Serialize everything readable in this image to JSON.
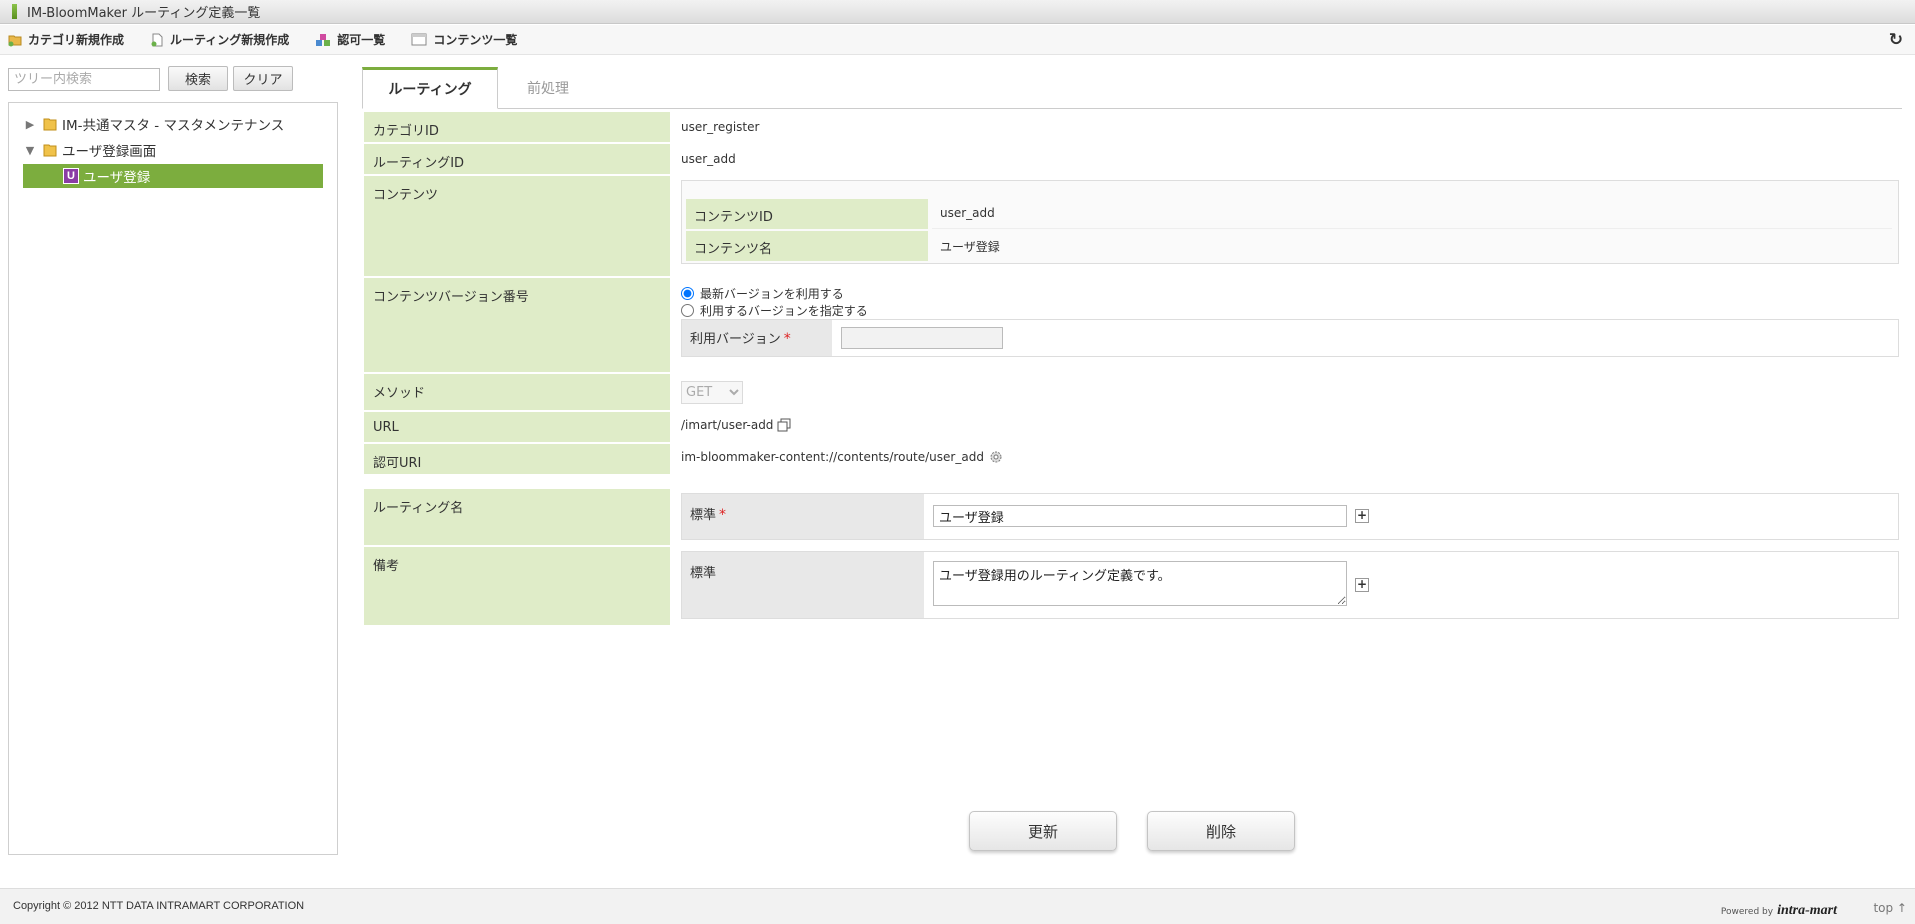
{
  "window": {
    "title": "IM-BloomMaker ルーティング定義一覧"
  },
  "toolbar": {
    "items": [
      {
        "label": "カテゴリ新規作成",
        "icon": "folder-new-icon"
      },
      {
        "label": "ルーティング新規作成",
        "icon": "document-new-icon"
      },
      {
        "label": "認可一覧",
        "icon": "shapes-icon"
      },
      {
        "label": "コンテンツ一覧",
        "icon": "window-icon"
      }
    ],
    "refresh_icon": "refresh-icon",
    "refresh_glyph": "↻"
  },
  "sidebar": {
    "search_placeholder": "ツリー内検索",
    "search_label": "検索",
    "clear_label": "クリア",
    "tree": [
      {
        "label": "IM-共通マスタ - マスタメンテナンス",
        "expanded": false
      },
      {
        "label": "ユーザ登録画面",
        "expanded": true
      },
      {
        "label": "ユーザ登録",
        "selected": true,
        "badge": "U"
      }
    ]
  },
  "tabs": [
    {
      "label": "ルーティング",
      "active": true
    },
    {
      "label": "前処理",
      "active": false
    }
  ],
  "form": {
    "category_id": {
      "label": "カテゴリID",
      "value": "user_register"
    },
    "routing_id": {
      "label": "ルーティングID",
      "value": "user_add"
    },
    "contents": {
      "label": "コンテンツ",
      "id_label": "コンテンツID",
      "id_value": "user_add",
      "name_label": "コンテンツ名",
      "name_value": "ユーザ登録"
    },
    "version": {
      "label": "コンテンツバージョン番号",
      "option_latest": "最新バージョンを利用する",
      "option_specify": "利用するバージョンを指定する",
      "use_version_label": "利用バージョン",
      "use_version_value": ""
    },
    "method": {
      "label": "メソッド",
      "value": "GET"
    },
    "url": {
      "label": "URL",
      "value": "/imart/user-add"
    },
    "auth_uri": {
      "label": "認可URI",
      "value": "im-bloommaker-content://contents/route/user_add"
    },
    "routing_name": {
      "label": "ルーティング名",
      "sub_label": "標準",
      "value": "ユーザ登録"
    },
    "remarks": {
      "label": "備考",
      "sub_label": "標準",
      "value": "ユーザ登録用のルーティング定義です。"
    },
    "required_mark": "*",
    "plus_glyph": "+"
  },
  "actions": {
    "update_label": "更新",
    "delete_label": "削除"
  },
  "footer": {
    "copyright": "Copyright © 2012 NTT DATA INTRAMART CORPORATION",
    "powered_by": "Powered by",
    "brand": "intra-mart",
    "top_label": "top ↑"
  },
  "colors": {
    "accent": "#7cad3e",
    "label_bg": "#dfecc8"
  }
}
